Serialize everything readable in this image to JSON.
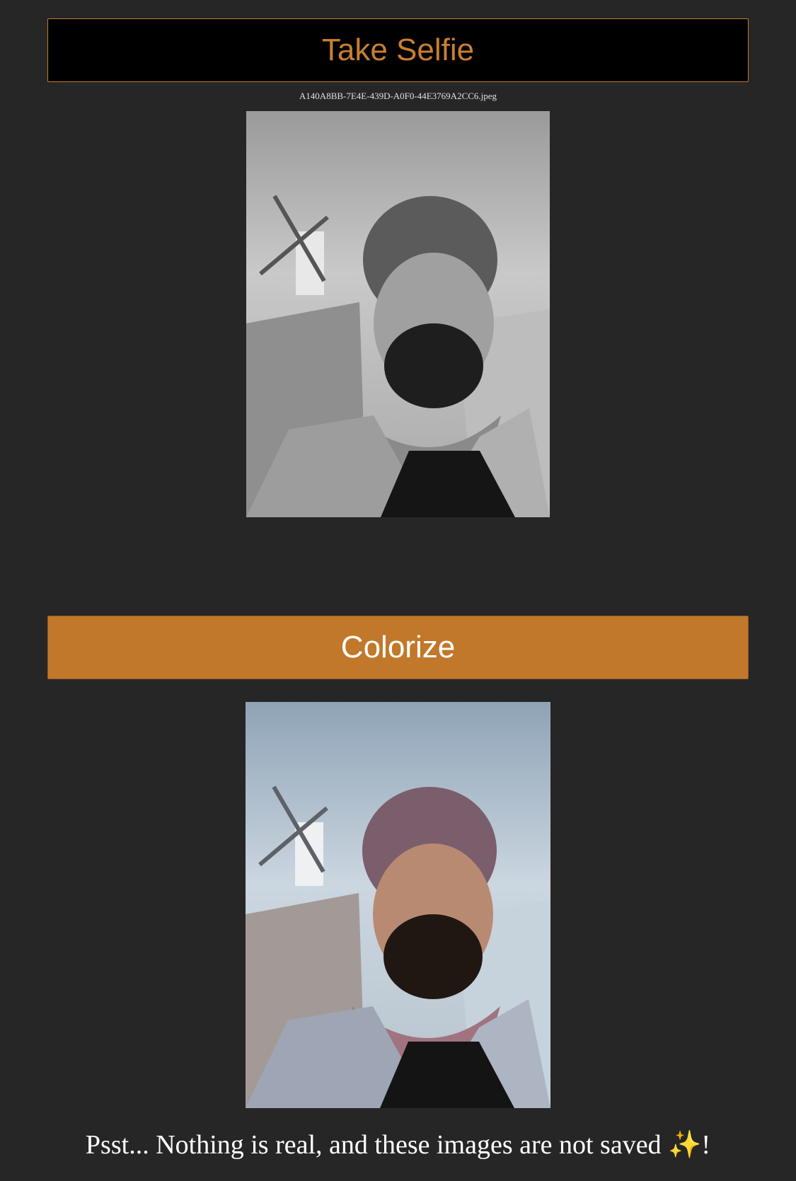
{
  "actions": {
    "take_selfie_label": "Take Selfie",
    "colorize_label": "Colorize"
  },
  "photo": {
    "filename": "A140A8BB-7E4E-439D-A0F0-44E3769A2CC6.jpeg"
  },
  "footer": {
    "text": "Psst... Nothing is real, and these images are not saved ",
    "sparkle": "✨",
    "end": "!"
  },
  "colors": {
    "accent": "#c1782a",
    "background": "#262626"
  }
}
